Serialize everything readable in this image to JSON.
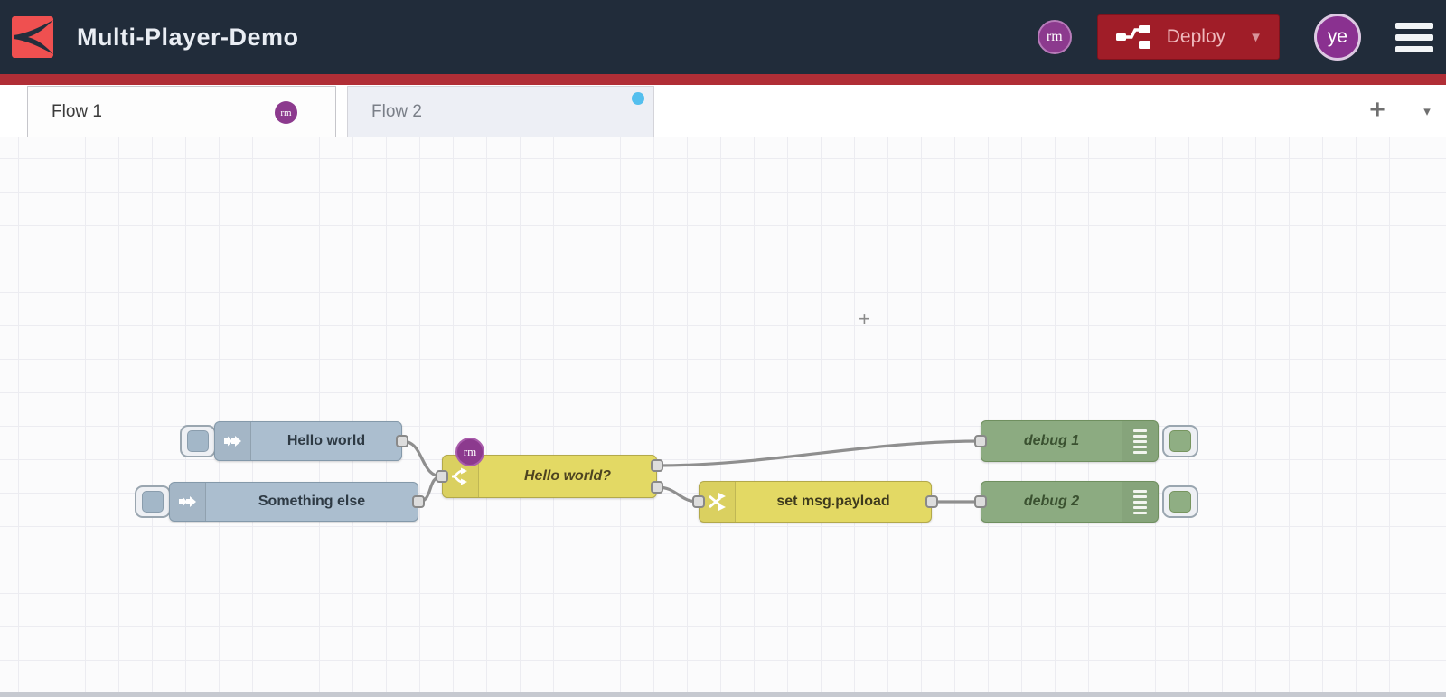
{
  "header": {
    "title": "Multi-Player-Demo",
    "logo_icon": "node-red-logo",
    "deploy": {
      "label": "Deploy",
      "caret": "▼",
      "icon": "deploy-nodes-icon"
    },
    "menu_icon": "hamburger-icon",
    "users": [
      {
        "initials": "rm",
        "color": "#8c3a8e"
      },
      {
        "initials": "ye",
        "color": "#8a3190"
      }
    ],
    "colors": {
      "bar": "#212c3a",
      "accent_red": "#b02e36",
      "deploy_red": "#a01d28"
    }
  },
  "tabs": {
    "items": [
      {
        "label": "Flow 1",
        "active": true,
        "badge": "rm"
      },
      {
        "label": "Flow 2",
        "active": false,
        "activity_dot": true
      }
    ],
    "add_button": "+",
    "menu_caret": "▾"
  },
  "canvas": {
    "cursor_mark": "+",
    "colors": {
      "inject_blue": "#abbecf",
      "function_yellow": "#e3d964",
      "debug_green": "#8cab81",
      "wire_gray": "#8f8f8f",
      "grid": "#ececf1"
    },
    "nodes": [
      {
        "id": "inject-hello-world",
        "type": "inject",
        "label": "Hello world",
        "icon": "inject-arrow-icon"
      },
      {
        "id": "inject-something-else",
        "type": "inject",
        "label": "Something else",
        "icon": "inject-arrow-icon"
      },
      {
        "id": "switch-hello-world",
        "type": "switch",
        "label": "Hello world?",
        "icon": "fork-arrows-icon",
        "badge": "rm",
        "outputs": 2
      },
      {
        "id": "change-set-payload",
        "type": "change",
        "label": "set msg.payload",
        "icon": "crossed-arrows-icon"
      },
      {
        "id": "debug-1",
        "type": "debug",
        "label": "debug 1",
        "icon": "list-lines-icon"
      },
      {
        "id": "debug-2",
        "type": "debug",
        "label": "debug 2",
        "icon": "list-lines-icon"
      }
    ],
    "wires": [
      {
        "from": "inject-hello-world",
        "to": "switch-hello-world"
      },
      {
        "from": "inject-something-else",
        "to": "switch-hello-world"
      },
      {
        "from": "switch-hello-world:1",
        "to": "debug-1"
      },
      {
        "from": "switch-hello-world:2",
        "to": "change-set-payload"
      },
      {
        "from": "change-set-payload",
        "to": "debug-2"
      }
    ]
  }
}
